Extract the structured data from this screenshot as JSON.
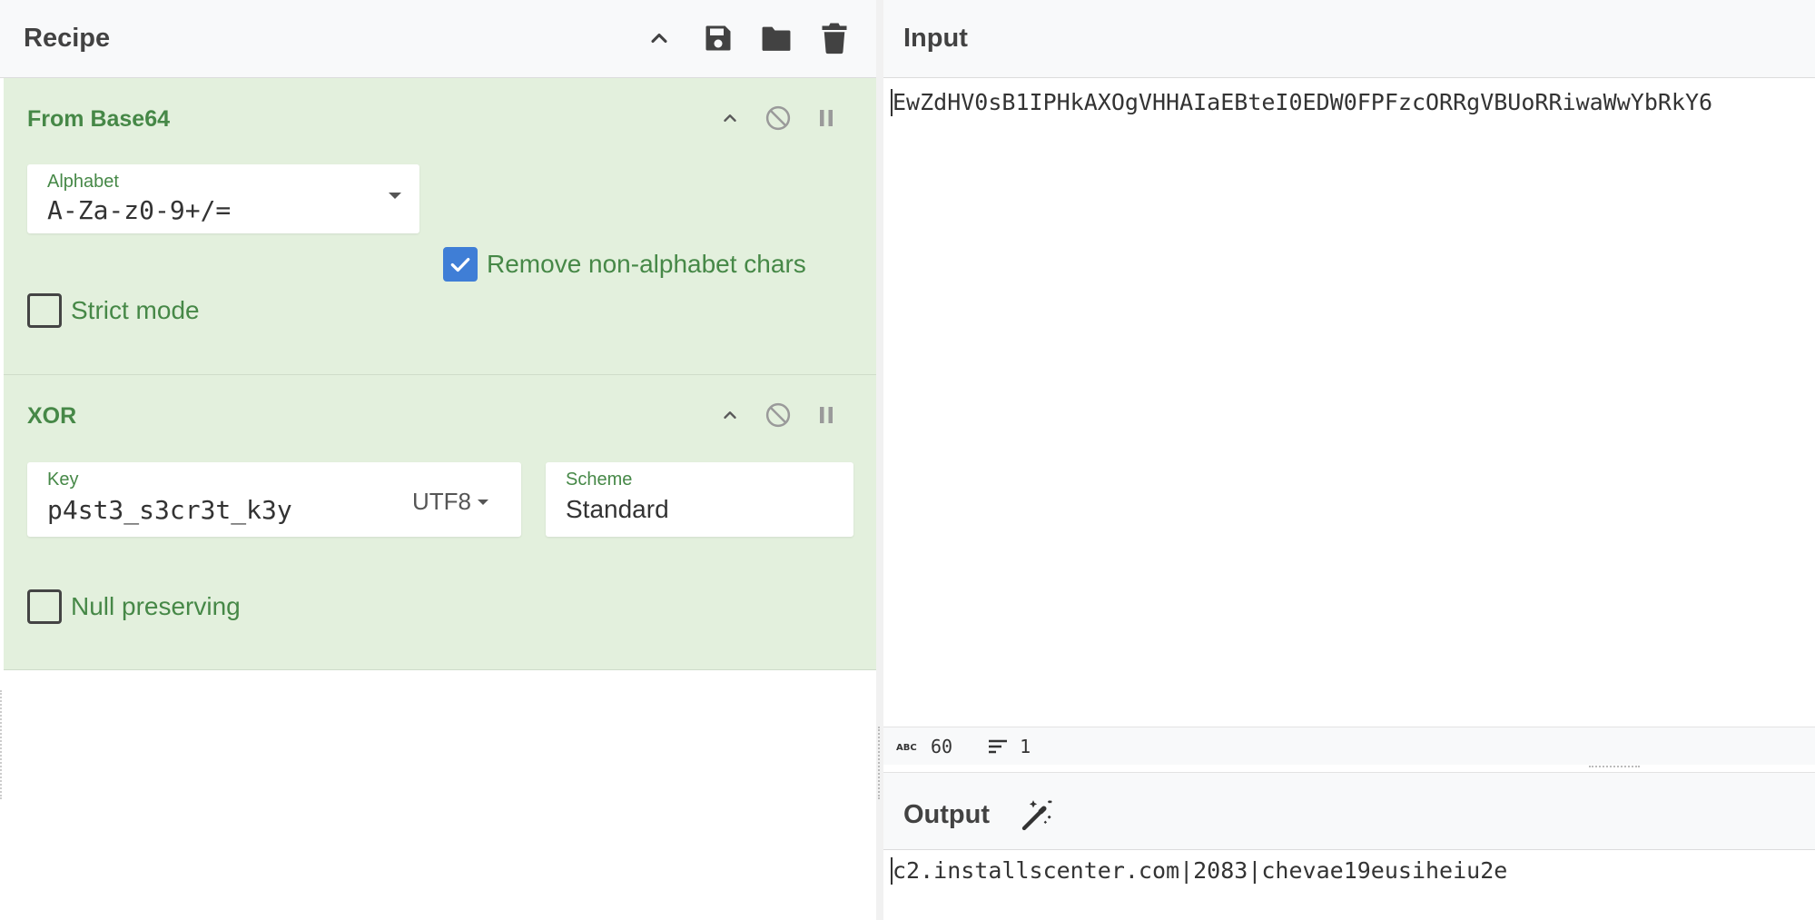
{
  "recipe": {
    "title": "Recipe",
    "icons": [
      "chevron-up-icon",
      "save-icon",
      "folder-icon",
      "trash-icon"
    ],
    "operations": [
      {
        "name": "From Base64",
        "alphabet_label": "Alphabet",
        "alphabet_value": "A-Za-z0-9+/=",
        "remove_non_alphabet_label": "Remove non-alphabet chars",
        "remove_non_alphabet_checked": true,
        "strict_mode_label": "Strict mode",
        "strict_mode_checked": false
      },
      {
        "name": "XOR",
        "key_label": "Key",
        "key_value": "p4st3_s3cr3t_k3y",
        "key_encoding": "UTF8",
        "scheme_label": "Scheme",
        "scheme_value": "Standard",
        "null_preserving_label": "Null preserving",
        "null_preserving_checked": false
      }
    ]
  },
  "input": {
    "title": "Input",
    "text": "EwZdHV0sB1IPHkAXOgVHHAIaEBteI0EDW0FPFzcORRgVBUoRRiwaWwYbRkY6",
    "char_count": "60",
    "line_count": "1"
  },
  "output": {
    "title": "Output",
    "text": "c2.installscenter.com|2083|chevae19eusiheiu2e"
  },
  "colors": {
    "op_background": "#e3f0dd",
    "op_text": "#468847",
    "checkbox_checked": "#3f7ed6"
  }
}
